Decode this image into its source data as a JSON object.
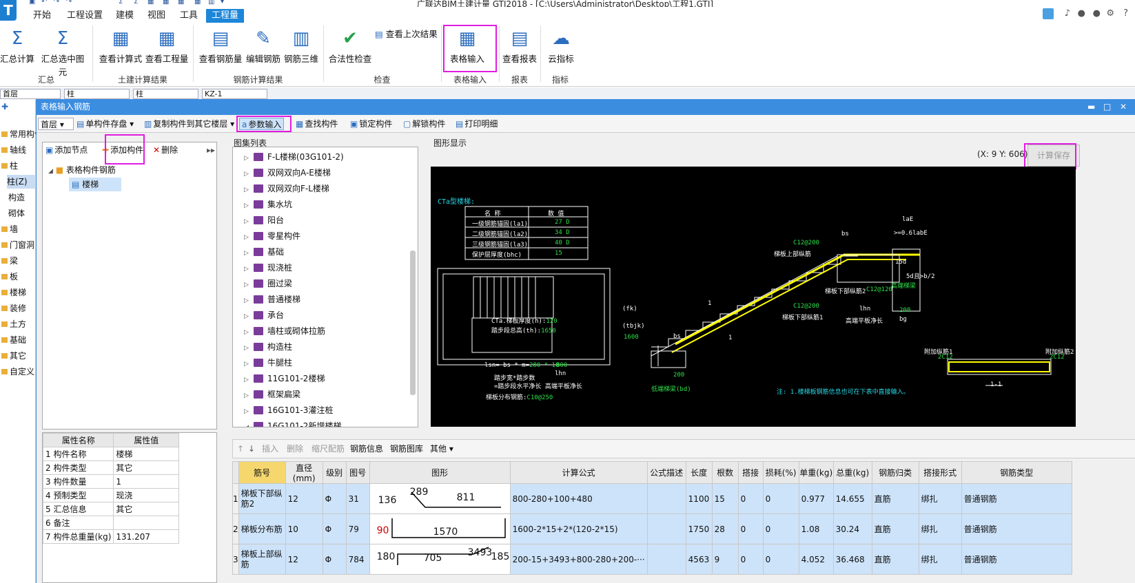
{
  "app": {
    "title": "广联达BIM土建计量 GTJ2018 - [C:\\Users\\Administrator\\Desktop\\工程1.GTJ]",
    "logo": "T"
  },
  "menubar": [
    "开始",
    "工程设置",
    "建模",
    "视图",
    "工具",
    "工程量"
  ],
  "ribbon": {
    "buttons": [
      {
        "label": "汇总计算",
        "icon": "Σ"
      },
      {
        "label": "汇总选中图元",
        "icon": "Σ"
      },
      {
        "label": "查看计算式",
        "icon": "▦"
      },
      {
        "label": "查看工程量",
        "icon": "▦"
      },
      {
        "label": "查看钢筋量",
        "icon": "▤"
      },
      {
        "label": "编辑钢筋",
        "icon": "✎"
      },
      {
        "label": "钢筋三维",
        "icon": "▥"
      },
      {
        "label": "合法性检查",
        "icon": "✔"
      },
      {
        "label": "查看上次结果",
        "icon": "▤"
      },
      {
        "label": "表格输入",
        "icon": "▦"
      },
      {
        "label": "查看报表",
        "icon": "▤"
      },
      {
        "label": "云指标",
        "icon": "☁"
      }
    ],
    "groups": [
      "汇总",
      "土建计算结果",
      "钢筋计算结果",
      "检查",
      "表格输入",
      "报表",
      "指标"
    ]
  },
  "ctrlbar": {
    "floor": "首层",
    "type1": "柱",
    "type2": "柱",
    "element": "KZ-1"
  },
  "leftnav": [
    "常用构件",
    "轴线",
    "柱",
    "柱(Z)",
    "构造",
    "砌体",
    "墙",
    "门窗洞",
    "梁",
    "板",
    "楼梯",
    "装修",
    "土方",
    "基础",
    "其它",
    "自定义"
  ],
  "dialog": {
    "title": "表格输入钢筋",
    "toolbar": {
      "floor": "首层",
      "save": "单构件存盘",
      "copy": "复制构件到其它楼层",
      "param": "参数输入",
      "find": "查找构件",
      "lock": "锁定构件",
      "unlock": "解锁构件",
      "print": "打印明细"
    },
    "tree_toolbar": {
      "add_node": "添加节点",
      "add_comp": "添加构件",
      "delete": "删除"
    },
    "tree": {
      "root": "表格构件钢筋",
      "child": "楼梯"
    },
    "atlas_title": "图集列表",
    "atlas": [
      "F-L楼梯(03G101-2)",
      "双网双向A-E楼梯",
      "双网双向F-L楼梯",
      "集水坑",
      "阳台",
      "零星构件",
      "基础",
      "现浇桩",
      "圈过梁",
      "普通楼梯",
      "承台",
      "墙柱或砌体拉筋",
      "构造柱",
      "牛腿柱",
      "11G101-2楼梯",
      "框架扁梁",
      "16G101-3灌注桩",
      "16G101-2新增楼梯"
    ],
    "gfx_title": "图形显示",
    "coords": "(X: 9 Y: 606)",
    "calc_save": "计算保存",
    "props": {
      "headers": [
        "属性名称",
        "属性值"
      ],
      "rows": [
        [
          "构件名称",
          "楼梯"
        ],
        [
          "构件类型",
          "其它"
        ],
        [
          "构件数量",
          "1"
        ],
        [
          "预制类型",
          "现浇"
        ],
        [
          "汇总信息",
          "其它"
        ],
        [
          "备注",
          ""
        ],
        [
          "构件总重量(kg)",
          "131.207"
        ]
      ]
    },
    "grid_toolbar": [
      "插入",
      "删除",
      "缩尺配筋",
      "钢筋信息",
      "钢筋图库",
      "其他"
    ],
    "grid": {
      "headers": [
        "筋号",
        "直径(mm)",
        "级别",
        "图号",
        "图形",
        "计算公式",
        "公式描述",
        "长度",
        "根数",
        "搭接",
        "损耗(%)",
        "单重(kg)",
        "总重(kg)",
        "钢筋归类",
        "搭接形式",
        "钢筋类型"
      ],
      "rows": [
        {
          "name": "梯板下部纵筋2",
          "d": "12",
          "grade": "Φ",
          "fig": "31",
          "shape": [
            "136",
            "289",
            "811"
          ],
          "formula": "800-280+100+480",
          "desc": "",
          "len": "1100",
          "n": "15",
          "lap": "0",
          "loss": "0",
          "unit": "0.977",
          "total": "14.655",
          "cat": "直筋",
          "lapform": "绑扎",
          "type": "普通钢筋"
        },
        {
          "name": "梯板分布筋",
          "d": "10",
          "grade": "Φ",
          "fig": "79",
          "shape": [
            "90",
            "1570"
          ],
          "formula": "1600-2*15+2*(120-2*15)",
          "desc": "",
          "len": "1750",
          "n": "28",
          "lap": "0",
          "loss": "0",
          "unit": "1.08",
          "total": "30.24",
          "cat": "直筋",
          "lapform": "绑扎",
          "type": "普通钢筋"
        },
        {
          "name": "梯板上部纵筋",
          "d": "12",
          "grade": "Φ",
          "fig": "784",
          "shape": [
            "180",
            "705",
            "3493",
            "185"
          ],
          "formula": "200-15+3493+800-280+200-···",
          "desc": "",
          "len": "4563",
          "n": "9",
          "lap": "0",
          "loss": "0",
          "unit": "4.052",
          "total": "36.468",
          "cat": "直筋",
          "lapform": "绑扎",
          "type": "普通钢筋"
        }
      ]
    },
    "drawing": {
      "title": "CTa型楼梯:",
      "table_headers": [
        "名 称",
        "数 值"
      ],
      "table_rows": [
        [
          "一级钢筋锚固(la1)",
          "27 D"
        ],
        [
          "二级钢筋锚固(la2)",
          "34 D"
        ],
        [
          "三级钢筋锚固(la3)",
          "40 D"
        ],
        [
          "保护层厚度(bhc)",
          "15"
        ]
      ],
      "labels": {
        "top_rebar": "梯板上部纵筋",
        "c12_top": "C12@200",
        "bot_rebar2": "梯板下部纵筋2",
        "c12_bot2": "C12@120",
        "bot_rebar1": "梯板下部纵筋1",
        "c12_bot1": "C12@200",
        "high_beam": "高端梯梁",
        "low_beam": "低端梯梁(bd)",
        "high_flat": "高端平板净长",
        "lhn": "lhn",
        "bs": "bs",
        "bg": "bg",
        "v200a": "200",
        "v200b": "200",
        "lae": "laE",
        "lae2": ">=0.6labE",
        "fifteen_d": "15d",
        "five_d": "5d且>b/2",
        "fk": "(fk)",
        "tbjk": "(tbjk)",
        "v1600": "1600",
        "thick": "CTa.梯板厚度(h):",
        "thick_v": "120",
        "stephgt": "踏步段总高(th):",
        "stephgt_v": "1650",
        "lsn": "lsn= bs * m=",
        "lsn_v": "280 * 10",
        "v800": "800",
        "lhn2": "lhn",
        "note1": "踏步宽*踏步数",
        "note2": "=踏步段水平净长  高端平板净长",
        "distrib": "梯板分布钢筋:",
        "distrib_v": "C10@250",
        "extra1": "附加纵筋1",
        "extra1_v": "2C12",
        "extra2": "附加纵筋2",
        "extra2_v": "2C12",
        "sect": "1-1",
        "note": "注: 1.楼梯板钢筋信息也可在下表中直接输入。",
        "l1": "1",
        "l2": "1"
      }
    }
  }
}
